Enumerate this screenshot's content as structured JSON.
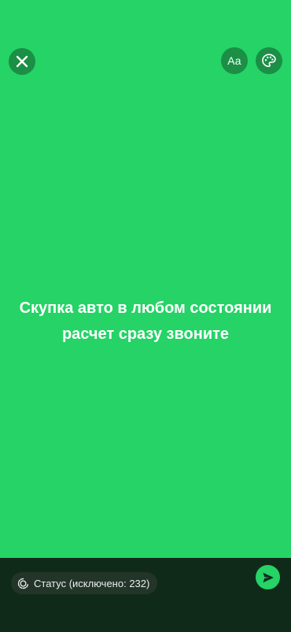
{
  "status": {
    "lines": [
      "Скупка авто в любом состоянии",
      "расчет сразу звоните"
    ],
    "background_color": "#25D366"
  },
  "toolbar": {
    "font_button_label": "Aa"
  },
  "bottom": {
    "audience_label": "Статус (исключено: 232)"
  },
  "icons": {
    "close": "close-icon",
    "palette": "palette-icon",
    "audience": "status-ring-icon",
    "send": "send-icon"
  }
}
